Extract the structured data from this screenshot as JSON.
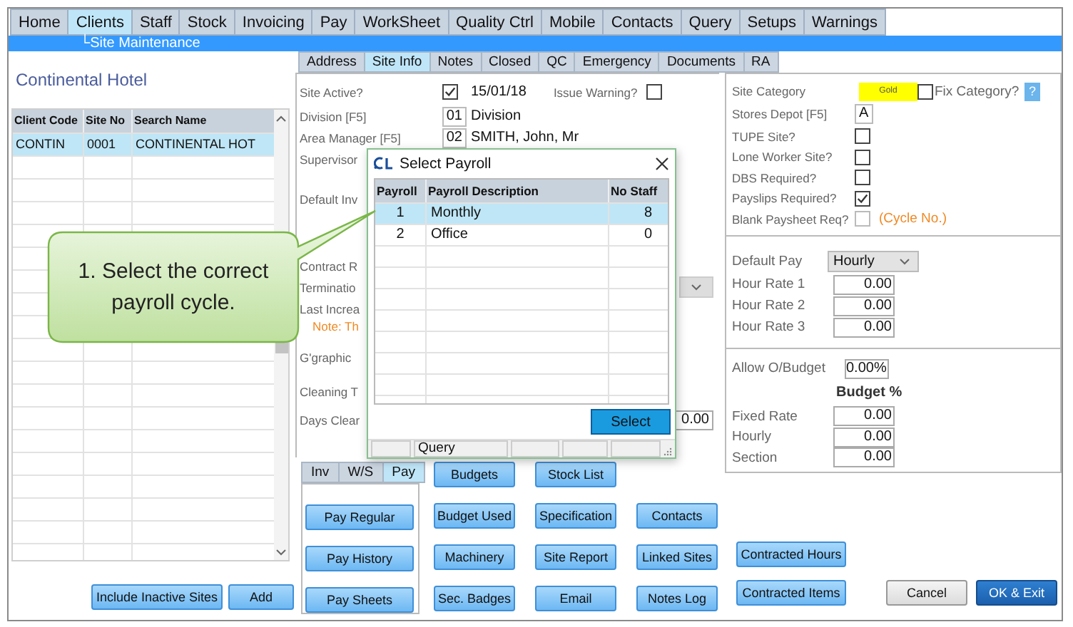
{
  "menu_tabs": [
    {
      "label": "Home",
      "selected": false
    },
    {
      "label": "Clients",
      "selected": true
    },
    {
      "label": "Staff",
      "selected": false
    },
    {
      "label": "Stock",
      "selected": false
    },
    {
      "label": "Invoicing",
      "selected": false
    },
    {
      "label": "Pay",
      "selected": false
    },
    {
      "label": "WorkSheet",
      "selected": false
    },
    {
      "label": "Quality Ctrl",
      "selected": false
    },
    {
      "label": "Mobile",
      "selected": false
    },
    {
      "label": "Contacts",
      "selected": false
    },
    {
      "label": "Query",
      "selected": false
    },
    {
      "label": "Setups",
      "selected": false
    },
    {
      "label": "Warnings",
      "selected": false
    }
  ],
  "breadcrumb": "└Site Maintenance",
  "site_list": {
    "title": "Continental Hotel",
    "columns": [
      "Client Code",
      "Site No",
      "Search Name"
    ],
    "rows": [
      {
        "cells": [
          "CONTIN",
          "0001",
          "CONTINENTAL HOT"
        ],
        "selected": true
      }
    ],
    "buttons": [
      "Include Inactive Sites",
      "Add"
    ]
  },
  "site_tabs": [
    {
      "label": "Address",
      "selected": false
    },
    {
      "label": "Site Info",
      "selected": true
    },
    {
      "label": "Notes",
      "selected": false
    },
    {
      "label": "Closed",
      "selected": false
    },
    {
      "label": "QC",
      "selected": false
    },
    {
      "label": "Emergency",
      "selected": false
    },
    {
      "label": "Documents",
      "selected": false
    },
    {
      "label": "RA",
      "selected": false
    }
  ],
  "site_info": {
    "site_active": {
      "label": "Site Active?",
      "checked": true,
      "date": "15/01/18"
    },
    "issue_warning": {
      "label": "Issue Warning?",
      "checked": false
    },
    "division": {
      "label": "Division [F5]",
      "code": "01",
      "value": "Division"
    },
    "area_manager": {
      "label": "Area Manager [F5]",
      "code": "02",
      "value": "SMITH, John, Mr"
    },
    "rows": [
      {
        "kind": "label",
        "text": "Supervisor"
      },
      {
        "kind": "label",
        "text": "Default Inv"
      },
      {
        "kind": "label",
        "text": "Contract R"
      },
      {
        "kind": "dropdown",
        "text": "Terminatio"
      },
      {
        "kind": "label",
        "text": "Last Increa"
      },
      {
        "kind": "note",
        "text": "Note: Th"
      },
      {
        "kind": "label",
        "text": "G'graphic"
      },
      {
        "kind": "label",
        "text": "Cleaning T"
      },
      {
        "kind": "field",
        "text": "Days Clear",
        "value": "0.00"
      }
    ]
  },
  "site_options": {
    "category": {
      "label": "Site Category",
      "value": "Gold"
    },
    "fix_category": {
      "label": "Fix Category?",
      "checked": false
    },
    "help": "?",
    "stores_depot": {
      "label": "Stores Depot [F5]",
      "value": "A"
    },
    "checks": [
      {
        "label": "TUPE Site?",
        "checked": false,
        "disabled": false
      },
      {
        "label": "Lone Worker Site?",
        "checked": false,
        "disabled": false
      },
      {
        "label": "DBS Required?",
        "checked": false,
        "disabled": false
      },
      {
        "label": "Payslips Required?",
        "checked": true,
        "disabled": false
      },
      {
        "label": "Blank Paysheet Req?",
        "checked": false,
        "disabled": true,
        "note": "(Cycle No.)"
      }
    ]
  },
  "pay_settings": {
    "default_pay": {
      "label": "Default Pay",
      "value": "Hourly"
    },
    "rates": [
      {
        "label": "Hour Rate 1",
        "value": "0.00"
      },
      {
        "label": "Hour Rate 2",
        "value": "0.00"
      },
      {
        "label": "Hour Rate 3",
        "value": "0.00"
      }
    ]
  },
  "budget": {
    "allow": {
      "label": "Allow O/Budget",
      "value": "0.00%"
    },
    "heading": "Budget %",
    "rows": [
      {
        "label": "Fixed Rate",
        "value": "0.00"
      },
      {
        "label": "Hourly",
        "value": "0.00"
      },
      {
        "label": "Section",
        "value": "0.00"
      }
    ]
  },
  "pay_tabs": [
    {
      "label": "Inv",
      "selected": false
    },
    {
      "label": "W/S",
      "selected": false
    },
    {
      "label": "Pay",
      "selected": true
    }
  ],
  "pay_buttons": [
    "Pay Regular",
    "Pay History",
    "Pay Sheets"
  ],
  "action_columns": [
    [
      "Budgets",
      "Budget Used",
      "Machinery",
      "Sec. Badges"
    ],
    [
      "Stock List",
      "Specification",
      "Site Report",
      "Email"
    ],
    [
      "Contacts",
      "Linked Sites",
      "Notes Log"
    ],
    [
      "Contracted Hours",
      "Contracted Items"
    ]
  ],
  "footer_buttons": [
    {
      "label": "Cancel",
      "kind": "secondary"
    },
    {
      "label": "OK & Exit",
      "kind": "primary"
    }
  ],
  "dialog": {
    "title": "Select Payroll",
    "columns": [
      "Payroll",
      "Payroll Description",
      "No Staff"
    ],
    "rows": [
      {
        "cells": [
          "1",
          "Monthly",
          "8"
        ],
        "selected": true
      },
      {
        "cells": [
          "2",
          "Office",
          "0"
        ],
        "selected": false
      }
    ],
    "button": "Select",
    "status": "Query"
  },
  "callout": {
    "text": "1. Select the correct payroll cycle."
  }
}
